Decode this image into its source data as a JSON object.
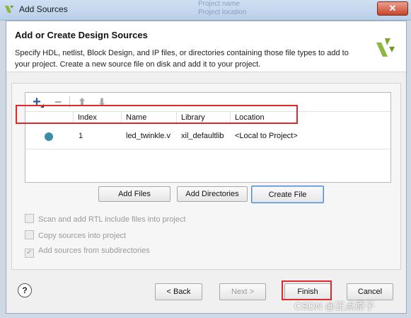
{
  "window": {
    "title": "Add Sources",
    "close_label": "✕",
    "background_fragments": [
      "Project name",
      "Project location"
    ]
  },
  "header": {
    "title": "Add or Create Design Sources",
    "description": "Specify HDL, netlist, Block Design, and IP files, or directories containing those file types to add to your project. Create a new source file on disk and add it to your project."
  },
  "table": {
    "columns": [
      "Index",
      "Name",
      "Library",
      "Location"
    ],
    "rows": [
      {
        "index": "1",
        "name": "led_twinkle.v",
        "library": "xil_defaultlib",
        "location": "<Local to Project>"
      }
    ]
  },
  "actions": {
    "add_files": "Add Files",
    "add_directories": "Add Directories",
    "create_file": "Create File"
  },
  "options": [
    {
      "label": "Scan and add RTL include files into project",
      "checked": false
    },
    {
      "label": "Copy sources into project",
      "checked": false
    },
    {
      "label": "Add sources from subdirectories",
      "checked": true
    }
  ],
  "footer": {
    "help": "?",
    "back": "< Back",
    "next": "Next >",
    "finish": "Finish",
    "cancel": "Cancel"
  },
  "watermark": "CSDN @正点原子",
  "colors": {
    "accent": "#4f87d8",
    "highlight": "#e0292d",
    "logo_green": "#8db73f",
    "status_dot": "#3c8ca6"
  }
}
